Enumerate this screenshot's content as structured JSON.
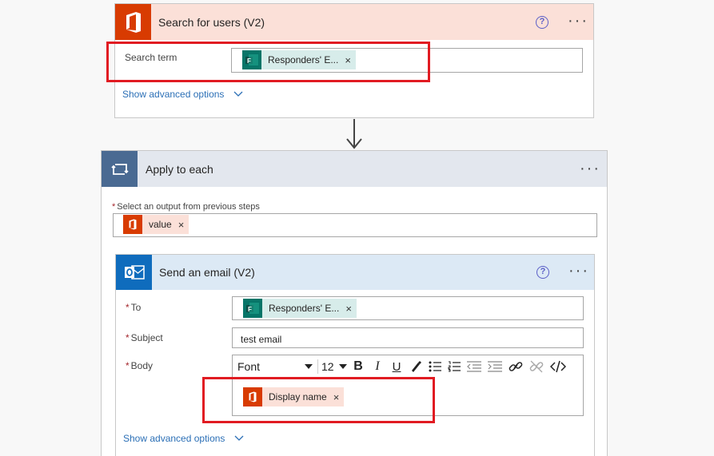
{
  "search_card": {
    "title": "Search for users (V2)",
    "help_icon": "?",
    "more_icon": "···",
    "field_label": "Search term",
    "token_label": "Responders' E...",
    "token_remove": "×",
    "advanced_link": "Show advanced options"
  },
  "apply_card": {
    "title": "Apply to each",
    "more_icon": "···",
    "required_mark": "*",
    "field_label": "Select an output from previous steps",
    "token_label": "value",
    "token_remove": "×"
  },
  "email_card": {
    "title": "Send an email (V2)",
    "help_icon": "?",
    "more_icon": "···",
    "required_mark": "*",
    "to_label": "To",
    "to_token_label": "Responders' E...",
    "to_token_remove": "×",
    "subject_label": "Subject",
    "subject_value": "test email",
    "body_label": "Body",
    "font_select": "Font",
    "font_size_select": "12",
    "toolbar": {
      "bold": "B",
      "italic": "I",
      "underline": "U"
    },
    "body_token_label": "Display name",
    "body_token_remove": "×",
    "advanced_link": "Show advanced options"
  },
  "colors": {
    "office_orange": "#d83b01",
    "forms_teal": "#077568",
    "outlook_blue": "#0f6cbd",
    "search_header_bg": "#fbe0d8",
    "email_header_bg": "#dce9f5",
    "apply_header_bg": "#e3e7ee",
    "apply_icon_bg": "#4a6a92",
    "highlight_red": "#e11b22"
  },
  "icons": {
    "office": "office-icon",
    "forms": "forms-icon",
    "outlook": "outlook-icon",
    "loop": "loop-icon"
  }
}
